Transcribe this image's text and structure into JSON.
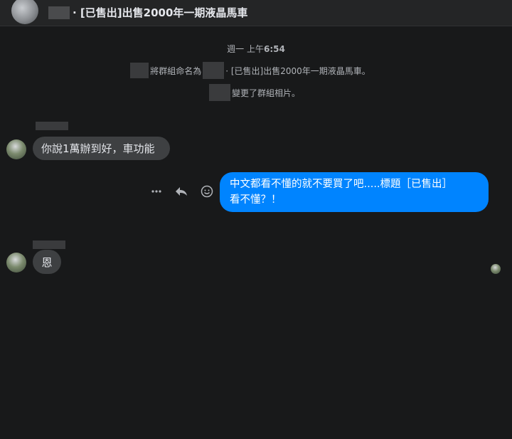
{
  "header": {
    "title": "· [已售出]出售2000年一期液晶馬車"
  },
  "system_messages": {
    "timestamp_prefix": "週一 上午",
    "timestamp_time": "6:54",
    "rename_prefix": "將群組命名為",
    "rename_suffix": "· [已售出]出售2000年一期液晶馬車。",
    "photo_changed": "變更了群組相片。"
  },
  "messages": [
    {
      "direction": "incoming",
      "text": "你說1萬辦到好，車功能"
    },
    {
      "direction": "outgoing",
      "lines": [
        "中文都看不懂的就不要買了吧.....標題［已售出］",
        "看不懂？！"
      ]
    },
    {
      "direction": "incoming",
      "text": "恩"
    }
  ],
  "message_actions": {
    "icons": [
      "more-icon",
      "reply-icon",
      "emoji-icon"
    ]
  },
  "colors": {
    "background": "#18191a",
    "incoming_bubble": "#3e4042",
    "outgoing_bubble": "#0084ff",
    "secondary_text": "#b0b3b8"
  }
}
